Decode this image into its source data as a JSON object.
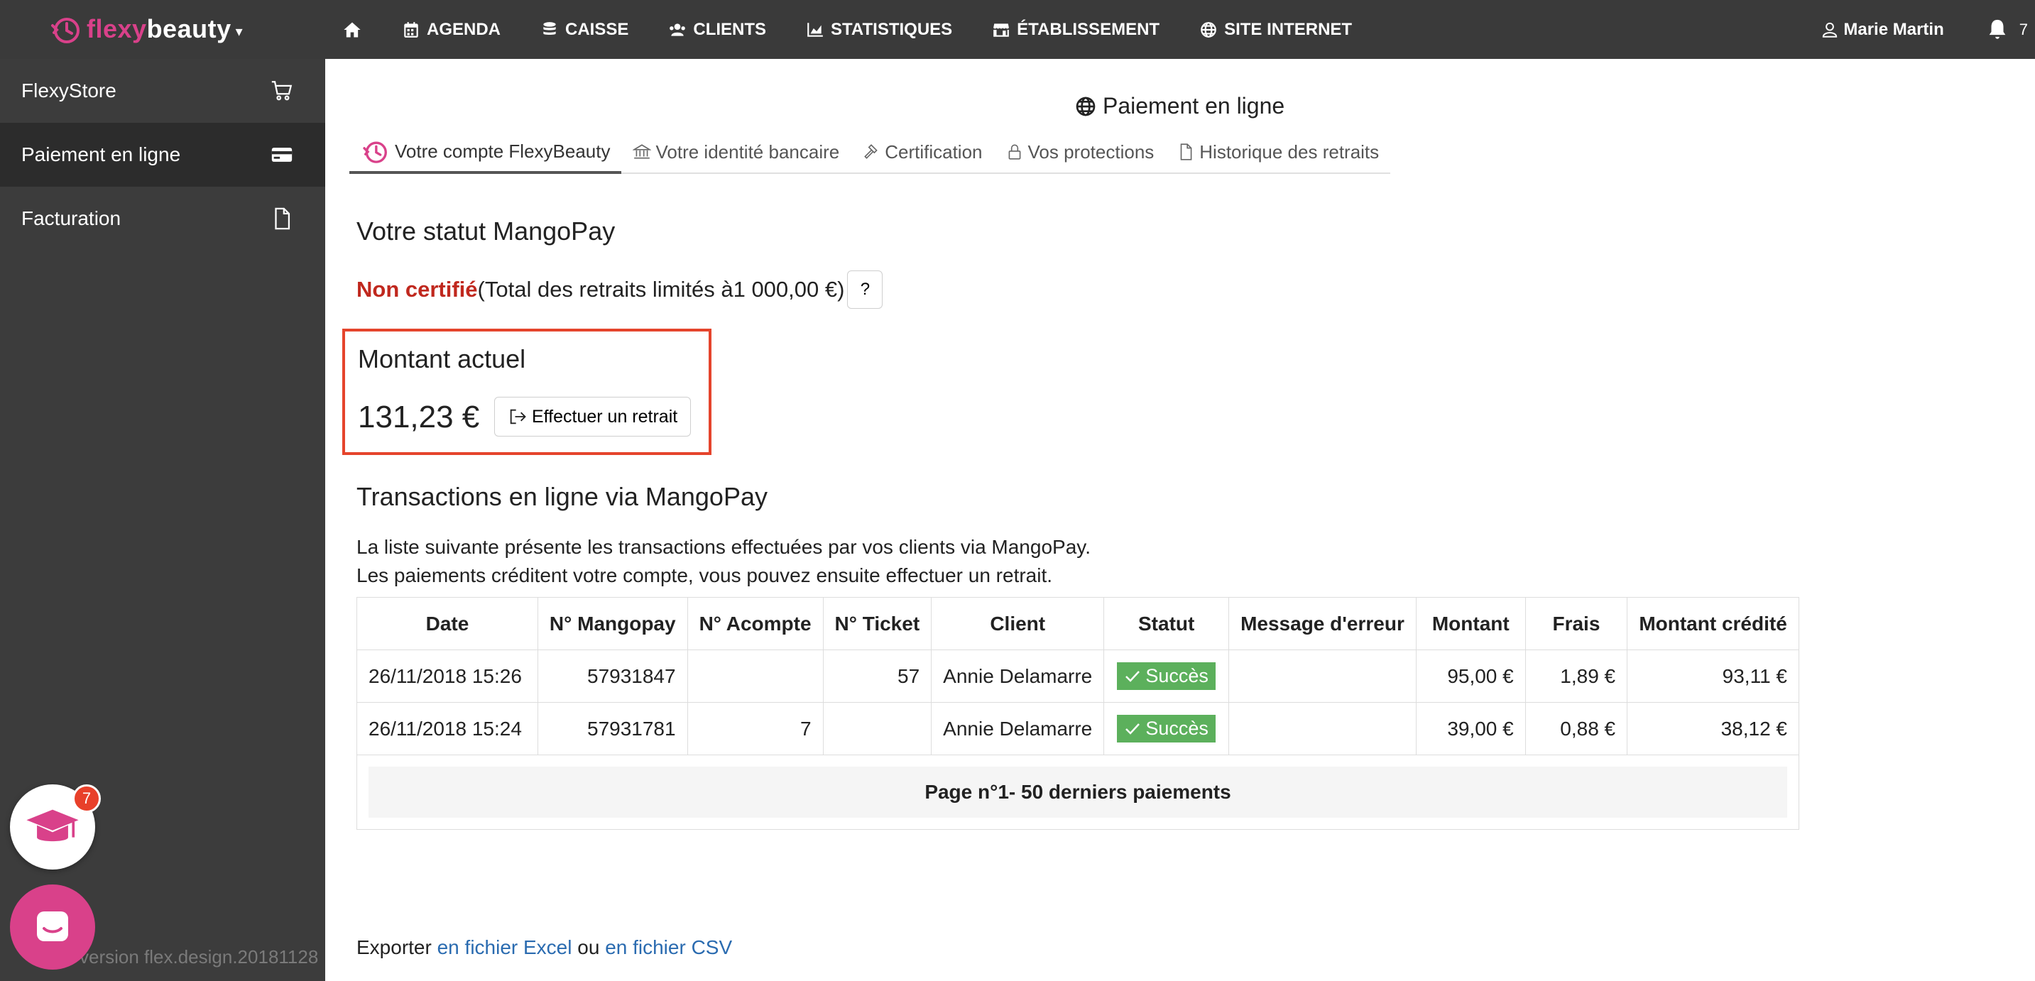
{
  "brand": {
    "part1": "flexy",
    "part2": "beauty",
    "caret": "▾",
    "logo_color": "#d9418a"
  },
  "nav": {
    "items": [
      {
        "label": "AGENDA"
      },
      {
        "label": "CAISSE"
      },
      {
        "label": "CLIENTS"
      },
      {
        "label": "STATISTIQUES"
      },
      {
        "label": "ÉTABLISSEMENT"
      },
      {
        "label": "SITE INTERNET"
      }
    ],
    "user": "Marie Martin",
    "notification_count": "7"
  },
  "sidebar": {
    "items": [
      {
        "label": "FlexyStore",
        "icon": "cart-icon"
      },
      {
        "label": "Paiement en ligne",
        "icon": "credit-card-icon"
      },
      {
        "label": "Facturation",
        "icon": "document-icon"
      }
    ],
    "version": "version flex.design.20181128",
    "academy_badge": "7"
  },
  "page": {
    "title": "Paiement en ligne",
    "tabs": [
      {
        "label": "Votre compte FlexyBeauty"
      },
      {
        "label": "Votre identité bancaire"
      },
      {
        "label": "Certification"
      },
      {
        "label": "Vos protections"
      },
      {
        "label": "Historique des retraits"
      }
    ]
  },
  "status": {
    "heading": "Votre statut MangoPay",
    "value": "Non certifié",
    "detail": "(Total des retraits limités à1 000,00 €)",
    "help_label": "?",
    "status_color": "#c0281e"
  },
  "amount": {
    "heading": "Montant actuel",
    "value": "131,23 €",
    "withdraw_label": "Effectuer un retrait"
  },
  "transactions": {
    "heading": "Transactions en ligne via MangoPay",
    "desc1": "La liste suivante présente les transactions effectuées par vos clients via MangoPay.",
    "desc2": "Les paiements créditent votre compte, vous pouvez ensuite effectuer un retrait.",
    "columns": [
      "Date",
      "N° Mangopay",
      "N° Acompte",
      "N° Ticket",
      "Client",
      "Statut",
      "Message d'erreur",
      "Montant",
      "Frais",
      "Montant crédité"
    ],
    "rows": [
      {
        "date": "26/11/2018 15:26",
        "mangopay": "57931847",
        "acompte": "",
        "ticket": "57",
        "client": "Annie Delamarre",
        "statut": "Succès",
        "message": "",
        "montant": "95,00 €",
        "frais": "1,89 €",
        "credite": "93,11 €"
      },
      {
        "date": "26/11/2018 15:24",
        "mangopay": "57931781",
        "acompte": "7",
        "ticket": "",
        "client": "Annie Delamarre",
        "statut": "Succès",
        "message": "",
        "montant": "39,00 €",
        "frais": "0,88 €",
        "credite": "38,12 €"
      }
    ],
    "pager": "Page n°1- 50 derniers paiements",
    "success_color": "#5cb05c"
  },
  "export": {
    "prefix": "Exporter ",
    "excel": "en fichier Excel",
    "middle": " ou ",
    "csv": "en fichier CSV"
  }
}
